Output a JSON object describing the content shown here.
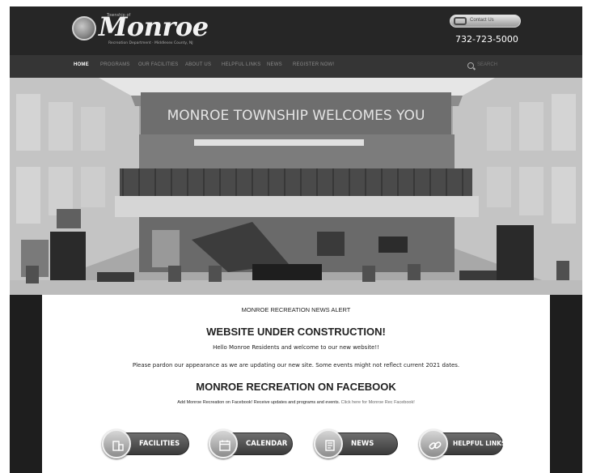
{
  "header": {
    "logo_prefix": "Township of",
    "logo_word": "Monroe",
    "logo_tagline": "Recreation Department · Middlesex County, NJ",
    "contact_button": "Contact Us",
    "phone": "732-723-5000"
  },
  "nav": {
    "items": [
      {
        "label": "HOME",
        "active": true
      },
      {
        "label": "PROGRAMS",
        "active": false
      },
      {
        "label": "OUR FACILITIES",
        "active": false
      },
      {
        "label": "ABOUT US",
        "active": false
      },
      {
        "label": "HELPFUL LINKS",
        "active": false
      },
      {
        "label": "NEWS",
        "active": false
      },
      {
        "label": "REGISTER NOW!",
        "active": false
      }
    ],
    "search_placeholder": "SEARCH"
  },
  "hero": {
    "banner_text": "MONROE TOWNSHIP WELCOMES YOU"
  },
  "main": {
    "alert_title": "MONROE RECREATION NEWS ALERT",
    "construction_heading": "WEBSITE UNDER CONSTRUCTION!",
    "hello_text": "Hello Monroe Residents and welcome to our new website!!",
    "pardon_text": "Please pardon our appearance as we are updating our new site. Some events might not reflect current 2021 dates.",
    "facebook_heading": "MONROE RECREATION ON FACEBOOK",
    "facebook_text": "Add Monroe Recreation on Facebook! Receive updates and programs and events.",
    "facebook_link": "Click here for Monroe Rec Facebook!"
  },
  "buttons": [
    {
      "label": "FACILITIES",
      "icon": "building-icon"
    },
    {
      "label": "CALENDAR",
      "icon": "calendar-icon"
    },
    {
      "label": "NEWS",
      "icon": "news-icon"
    },
    {
      "label": "HELPFUL LINKS",
      "icon": "link-icon"
    }
  ],
  "colors": {
    "header_bg": "#262626",
    "nav_bg": "#353535",
    "content_bg": "#ffffff"
  }
}
